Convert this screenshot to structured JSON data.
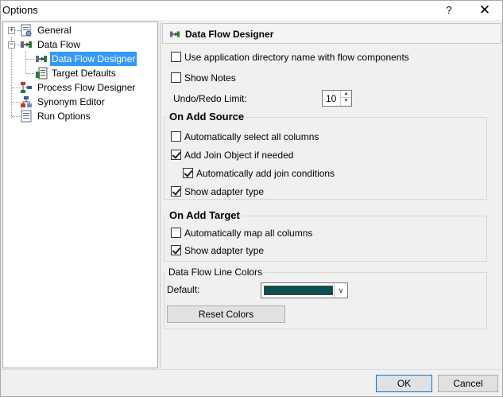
{
  "window": {
    "title": "Options",
    "help_glyph": "?",
    "close_glyph": "✕"
  },
  "tree": {
    "items": [
      {
        "label": "General",
        "icon": "settings-doc-icon"
      },
      {
        "label": "Data Flow",
        "icon": "data-flow-icon"
      },
      {
        "label": "Data Flow Designer",
        "icon": "data-flow-designer-icon",
        "selected": true
      },
      {
        "label": "Target Defaults",
        "icon": "target-defaults-icon"
      },
      {
        "label": "Process Flow Designer",
        "icon": "process-flow-icon"
      },
      {
        "label": "Synonym Editor",
        "icon": "synonym-editor-icon"
      },
      {
        "label": "Run Options",
        "icon": "run-options-icon"
      }
    ]
  },
  "panel": {
    "title": "Data Flow Designer",
    "use_app_dir_label": "Use application directory name with flow components",
    "use_app_dir_checked": false,
    "show_notes_label": "Show Notes",
    "show_notes_checked": false,
    "undo_redo_label": "Undo/Redo Limit:",
    "undo_redo_value": "10"
  },
  "on_add_source": {
    "title": "On Add Source",
    "auto_select_label": "Automatically select all columns",
    "auto_select_checked": false,
    "add_join_label": "Add Join Object if needed",
    "add_join_checked": true,
    "auto_join_label": "Automatically add join conditions",
    "auto_join_checked": true,
    "show_adapter_label": "Show adapter type",
    "show_adapter_checked": true
  },
  "on_add_target": {
    "title": "On Add Target",
    "auto_map_label": "Automatically map all columns",
    "auto_map_checked": false,
    "show_adapter_label": "Show adapter type",
    "show_adapter_checked": true
  },
  "line_colors": {
    "title": "Data Flow Line Colors",
    "default_label": "Default:",
    "default_color": "#0b4f4f",
    "reset_label": "Reset Colors"
  },
  "footer": {
    "ok_label": "OK",
    "cancel_label": "Cancel"
  }
}
